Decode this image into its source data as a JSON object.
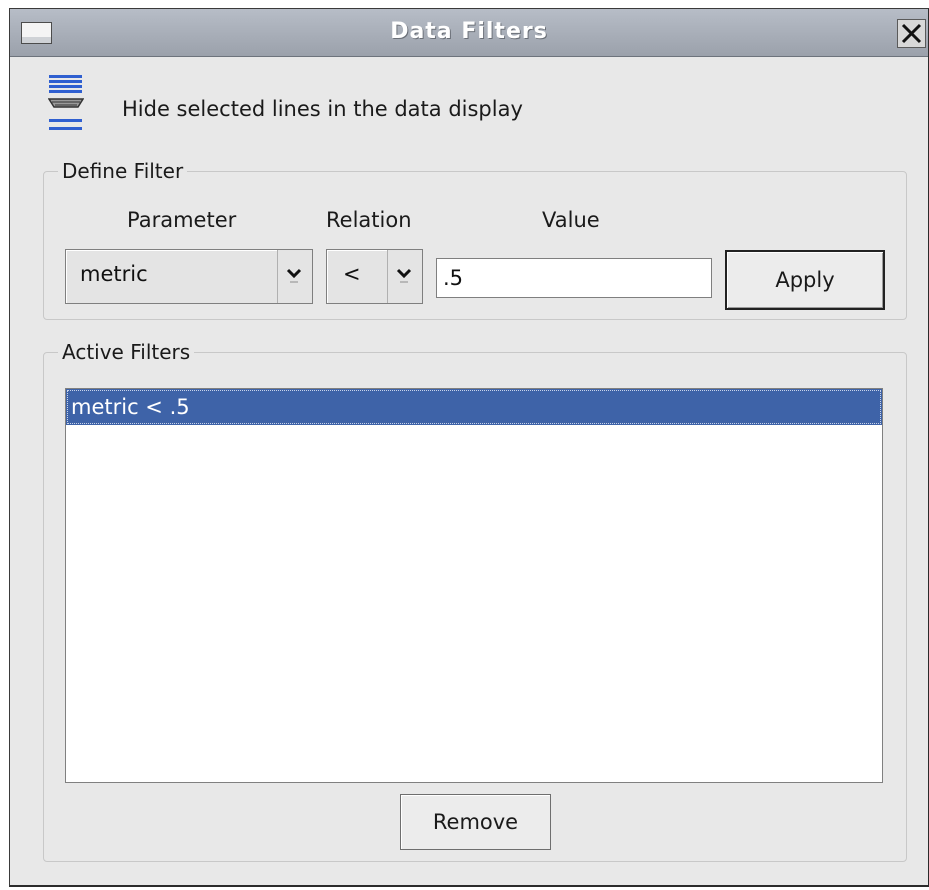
{
  "window": {
    "title": "Data Filters"
  },
  "description": "Hide selected lines in the data display",
  "define_filter": {
    "legend": "Define Filter",
    "parameter_label": "Parameter",
    "relation_label": "Relation",
    "value_label": "Value",
    "parameter_value": "metric",
    "relation_value": "<",
    "value_input": ".5",
    "apply_label": "Apply"
  },
  "active_filters": {
    "legend": "Active Filters",
    "items": [
      "metric < .5"
    ],
    "selected_index": 0,
    "remove_label": "Remove"
  },
  "icons": {
    "window_menu": "window-menu-icon",
    "close": "close-icon",
    "filter": "filter-lines-icon",
    "dropdown": "chevron-down-icon"
  },
  "colors": {
    "selection": "#3e63a8",
    "filter_icon": "#2f5fd0"
  }
}
